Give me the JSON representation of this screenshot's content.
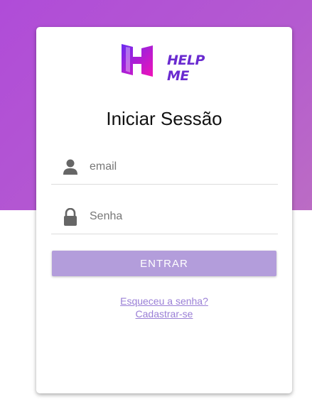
{
  "brand": {
    "name": "HELP ME",
    "logo_colors": [
      "#7b2ff7",
      "#f107a3"
    ]
  },
  "login": {
    "title": "Iniciar Sessão",
    "email_placeholder": "email",
    "password_placeholder": "Senha",
    "submit_label": "ENTRAR",
    "forgot_label": "Esqueceu a senha?",
    "signup_label": "Cadastrar-se"
  },
  "icons": {
    "email": "person-icon",
    "password": "lock-icon"
  },
  "colors": {
    "background_gradient": "#b04cd8",
    "button": "#b39ddb",
    "link": "#9a7fd6"
  }
}
